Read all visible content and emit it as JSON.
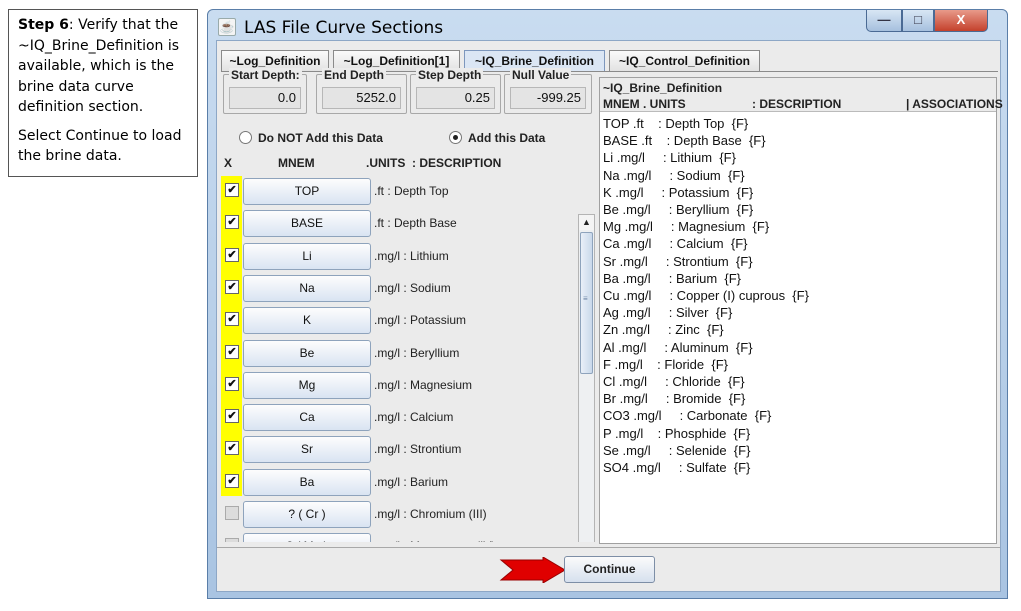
{
  "callout": {
    "step_label": "Step 6",
    "step_text": ": Verify that the ~IQ_Brine_Definition is available, which is the brine data curve definition section.",
    "note": "Select Continue to load the brine data."
  },
  "window": {
    "title": "LAS File Curve Sections",
    "controls": {
      "minimize": "—",
      "maximize": "□",
      "close": "X"
    }
  },
  "tabs": [
    {
      "label": "~Log_Definition"
    },
    {
      "label": "~Log_Definition[1]"
    },
    {
      "label": "~IQ_Brine_Definition"
    },
    {
      "label": "~IQ_Control_Definition"
    }
  ],
  "depth": {
    "start_label": "Start Depth:",
    "start_value": "0.0",
    "end_label": "End Depth",
    "end_value": "5252.0",
    "step_label": "Step Depth",
    "step_value": "0.25",
    "null_label": "Null Value",
    "null_value": "-999.25"
  },
  "radio": {
    "not_add": "Do NOT Add this Data",
    "add": "Add this Data",
    "selected": "add"
  },
  "columns": {
    "x": "X",
    "mnem": "MNEM",
    "units_desc": ".UNITS  : DESCRIPTION"
  },
  "curves": [
    {
      "mnem": "TOP",
      "desc": ".ft : Depth Top",
      "checked": true
    },
    {
      "mnem": "BASE",
      "desc": ".ft : Depth Base",
      "checked": true
    },
    {
      "mnem": "Li",
      "desc": ".mg/l : Lithium",
      "checked": true
    },
    {
      "mnem": "Na",
      "desc": ".mg/l : Sodium",
      "checked": true
    },
    {
      "mnem": "K",
      "desc": ".mg/l : Potassium",
      "checked": true
    },
    {
      "mnem": "Be",
      "desc": ".mg/l : Beryllium",
      "checked": true
    },
    {
      "mnem": "Mg",
      "desc": ".mg/l : Magnesium",
      "checked": true
    },
    {
      "mnem": "Ca",
      "desc": ".mg/l : Calcium",
      "checked": true
    },
    {
      "mnem": "Sr",
      "desc": ".mg/l : Strontium",
      "checked": true
    },
    {
      "mnem": "Ba",
      "desc": ".mg/l : Barium",
      "checked": true
    },
    {
      "mnem": "? ( Cr )",
      "desc": ".mg/l : Chromium (III)",
      "checked": false
    },
    {
      "mnem": "? ( Mn )",
      "desc": ".mg/l : Manganese (IV)",
      "checked": false
    }
  ],
  "check_mark": "✔",
  "preview": {
    "title": "~IQ_Brine_Definition",
    "col_mnem": "MNEM . UNITS",
    "col_desc": ": DESCRIPTION",
    "col_assoc": "| ASSOCIATIONS",
    "lines": [
      "TOP .ft    : Depth Top  {F}",
      "BASE .ft    : Depth Base  {F}",
      "Li .mg/l     : Lithium  {F}",
      "Na .mg/l     : Sodium  {F}",
      "K .mg/l     : Potassium  {F}",
      "Be .mg/l     : Beryllium  {F}",
      "Mg .mg/l     : Magnesium  {F}",
      "Ca .mg/l     : Calcium  {F}",
      "Sr .mg/l     : Strontium  {F}",
      "Ba .mg/l     : Barium  {F}",
      "Cu .mg/l     : Copper (I) cuprous  {F}",
      "Ag .mg/l     : Silver  {F}",
      "Zn .mg/l     : Zinc  {F}",
      "Al .mg/l     : Aluminum  {F}",
      "F .mg/l    : Floride  {F}",
      "Cl .mg/l     : Chloride  {F}",
      "Br .mg/l     : Bromide  {F}",
      "CO3 .mg/l     : Carbonate  {F}",
      "P .mg/l    : Phosphide  {F}",
      "Se .mg/l     : Selenide  {F}",
      "SO4 .mg/l     : Sulfate  {F}"
    ]
  },
  "continue_label": "Continue",
  "colors": {
    "highlight": "#ffff00",
    "arrow": "#e00000",
    "frame": "#a9c4e2"
  }
}
